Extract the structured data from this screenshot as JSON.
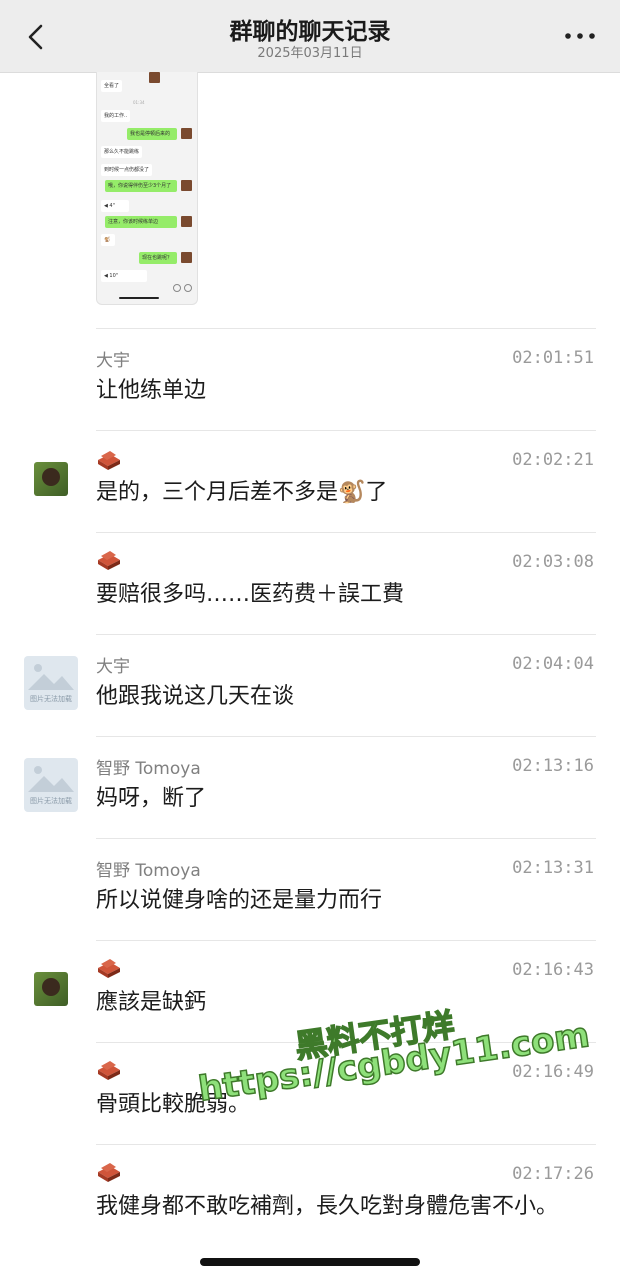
{
  "header": {
    "title": "群聊的聊天记录",
    "date": "2025年03月11日",
    "back_icon": "chevron-left-icon",
    "more_icon": "more-dots-icon"
  },
  "thumbnail": {
    "lines": [
      "全看了",
      "我的工作..",
      "我也是停顿后来的",
      "那么久不能跳练",
      "到时候一点伤都没了",
      "哦，你说得伴伤至少3个月了",
      "注意，你该时候练单边",
      "现在也跳呢？"
    ]
  },
  "messages": [
    {
      "sender": "大宇",
      "time": "02:01:51",
      "text": "让他练单边",
      "avatar": "none"
    },
    {
      "sender": "",
      "time": "02:02:21",
      "text": "是的，三个月后差不多是",
      "emoji": "🐒",
      "text_after": "了",
      "avatar": "monkey"
    },
    {
      "sender": "",
      "time": "02:03:08",
      "text": "要赔很多吗……医药费＋誤工費",
      "avatar": "none"
    },
    {
      "sender": "大宇",
      "time": "02:04:04",
      "text": "他跟我说这几天在谈",
      "avatar": "placeholder"
    },
    {
      "sender": "智野 Tomoya",
      "time": "02:13:16",
      "text": "妈呀，断了",
      "avatar": "placeholder"
    },
    {
      "sender": "智野 Tomoya",
      "time": "02:13:31",
      "text": "所以说健身啥的还是量力而行",
      "avatar": "none"
    },
    {
      "sender": "",
      "time": "02:16:43",
      "text": "應該是缺鈣",
      "avatar": "monkey"
    },
    {
      "sender": "",
      "time": "02:16:49",
      "text": "骨頭比較脆弱。",
      "avatar": "none"
    },
    {
      "sender": "",
      "time": "02:17:26",
      "text": "我健身都不敢吃補劑，長久吃對身體危害不小。",
      "avatar": "none"
    }
  ],
  "avatar_caption": "图片无法加载",
  "watermark": {
    "line1": "黑料不打烊",
    "line2": "https://cgbdy11.com"
  }
}
